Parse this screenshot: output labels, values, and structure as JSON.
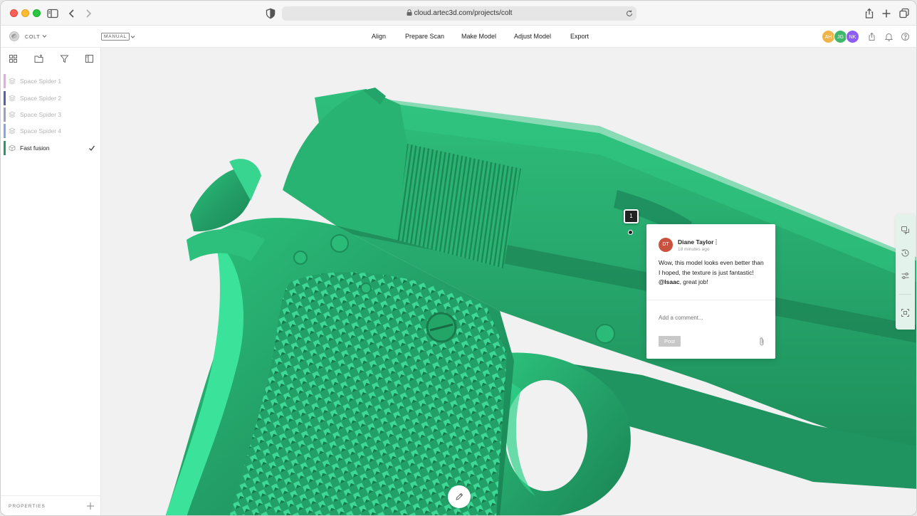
{
  "browser": {
    "url": "cloud.artec3d.com/projects/colt"
  },
  "header": {
    "project_name": "COLT",
    "mode": "MANUAL",
    "menu": [
      "Align",
      "Prepare Scan",
      "Make Model",
      "Adjust Model",
      "Export"
    ],
    "avatars": [
      {
        "initials": "AH",
        "color": "#f0b54a"
      },
      {
        "initials": "JG",
        "color": "#3fb86a"
      },
      {
        "initials": "NK",
        "color": "#8b5cf6"
      }
    ]
  },
  "sidebar": {
    "layers": [
      {
        "name": "Space Spider 1",
        "color": "#e8a6e8",
        "active": false
      },
      {
        "name": "Space Spider 2",
        "color": "#5560b0",
        "active": false
      },
      {
        "name": "Space Spider 3",
        "color": "#9aa0c9",
        "active": false
      },
      {
        "name": "Space Spider 4",
        "color": "#86a6e6",
        "active": false
      },
      {
        "name": "Fast fusion",
        "color": "#2e9a63",
        "active": true
      }
    ],
    "properties_label": "PROPERTIES"
  },
  "viewport": {
    "model_color": "#27a36a",
    "pin_number": "1"
  },
  "comment": {
    "initials": "DT",
    "author": "Diane Taylor",
    "time": "18 minutes ago",
    "body_before": "Wow, this model looks even better than I hoped, the texture is just fantastic! ",
    "mention": "@Isaac",
    "body_after": ", great job!",
    "placeholder": "Add a comment...",
    "post_label": "Post"
  }
}
